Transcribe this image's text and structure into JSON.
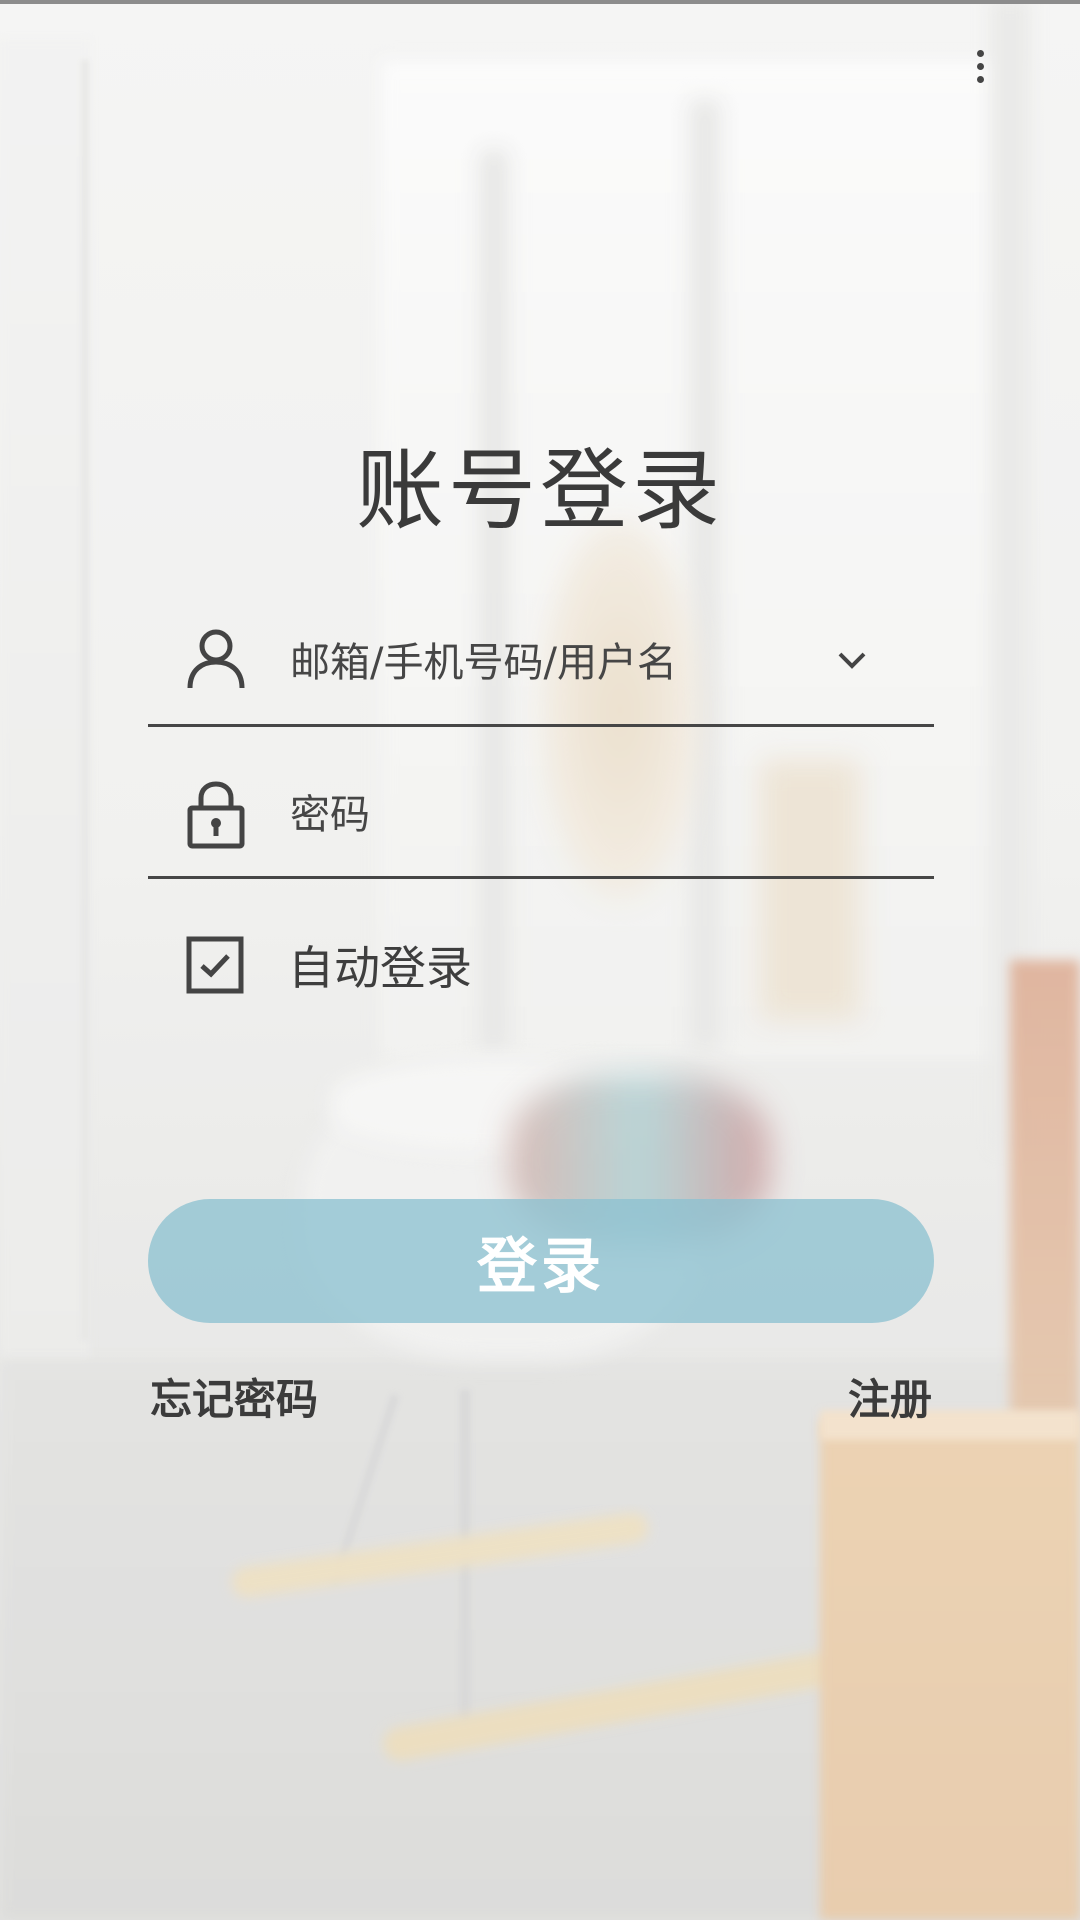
{
  "page": {
    "title": "账号登录"
  },
  "menu": {
    "icon": "more-vertical-icon"
  },
  "form": {
    "account": {
      "icon": "user-icon",
      "placeholder": "邮箱/手机号码/用户名",
      "value": "",
      "dropdown_icon": "chevron-down-icon"
    },
    "password": {
      "icon": "lock-icon",
      "placeholder": "密码",
      "value": ""
    },
    "auto_login": {
      "label": "自动登录",
      "checked": true
    },
    "submit_label": "登录"
  },
  "links": {
    "forgot_password": "忘记密码",
    "register": "注册"
  },
  "colors": {
    "button_bg": "#8DC1D1",
    "text": "#3A3A3A",
    "underline": "#464646"
  }
}
